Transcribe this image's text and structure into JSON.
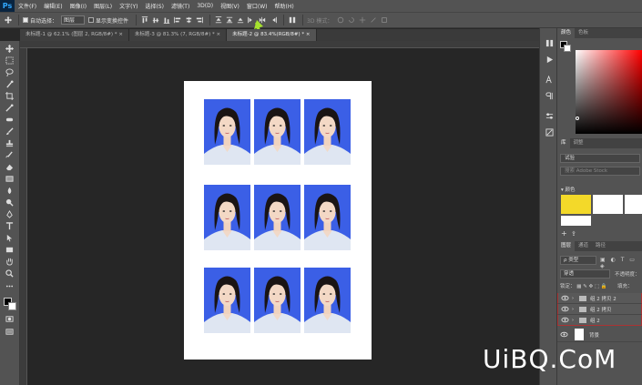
{
  "app": {
    "logo": "Ps"
  },
  "menu": [
    "文件(F)",
    "编辑(E)",
    "图像(I)",
    "图层(L)",
    "文字(Y)",
    "选择(S)",
    "滤镜(T)",
    "3D(D)",
    "视图(V)",
    "窗口(W)",
    "帮助(H)"
  ],
  "options": {
    "auto_select_label": "自动选择：",
    "auto_select_value": "图层",
    "show_transform_label": "显示变换控件",
    "mode_label": "3D 模式："
  },
  "tabs": [
    {
      "label": "未标题-1 @ 62.1% (图层 2, RGB/8#) *",
      "active": false
    },
    {
      "label": "未标题-3 @ 81.3% (7, RGB/8#) *",
      "active": false
    },
    {
      "label": "未标题-2 @ 83.4%(RGB/8#) *",
      "active": true
    }
  ],
  "panels": {
    "color_tabs": [
      "颜色",
      "色板"
    ],
    "library_tabs": [
      "库",
      "调整"
    ],
    "library_name": "试验",
    "library_search": "搜索 Adobe Stock",
    "library_section": "颜色",
    "swatch_colors": [
      "#f3d929",
      "#ffffff",
      "#ffffff",
      "#ffffff"
    ],
    "layer_tabs": [
      "图层",
      "通道",
      "路径"
    ],
    "layer_filter": "类型",
    "blend_mode": "穿透",
    "opacity_label": "不透明度：",
    "lock_label": "锁定：",
    "fill_label": "填充：",
    "layers": [
      {
        "name": "组 2 拷贝 2",
        "type": "group"
      },
      {
        "name": "组 2 拷贝",
        "type": "group"
      },
      {
        "name": "组 2",
        "type": "group"
      },
      {
        "name": "背景",
        "type": "background"
      }
    ]
  },
  "document": {
    "photo_background": "#3b5fe6",
    "rows": 3,
    "cols": 3
  },
  "accent": {
    "arrow": "#a6e22e",
    "selection": "#aa3333"
  },
  "watermark": "UiBQ.CoM"
}
